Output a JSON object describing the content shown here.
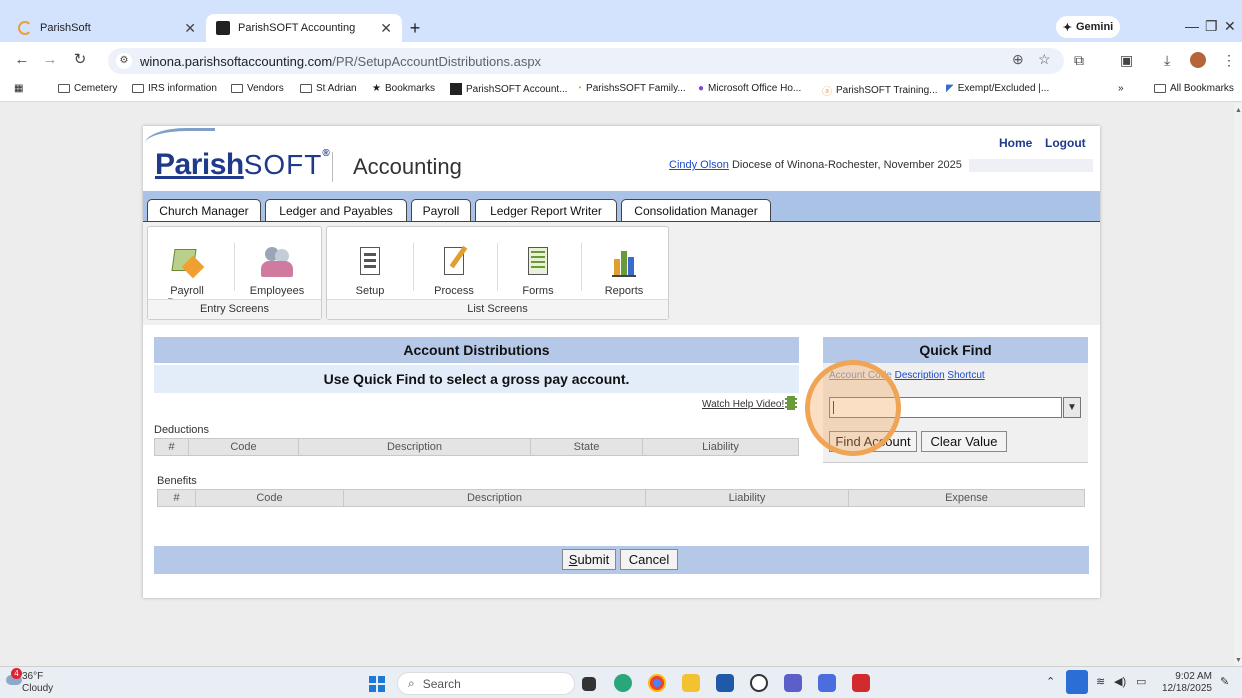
{
  "browser": {
    "tabs": [
      {
        "label": "ParishSoft"
      },
      {
        "label": "ParishSOFT Accounting"
      }
    ],
    "gemini_label": "Gemini",
    "url_host": "winona.parishsoftaccounting.com",
    "url_path": "/PR/SetupAccountDistributions.aspx",
    "bookmarks": [
      "Cemetery",
      "IRS information",
      "Vendors",
      "St Adrian",
      "Bookmarks",
      "ParishSOFT Account...",
      "ParishsSOFT Family...",
      "Microsoft Office Ho...",
      "ParishSOFT Training...",
      "Exempt/Excluded |..."
    ],
    "all_bookmarks": "All Bookmarks",
    "more": "»"
  },
  "header": {
    "logo_parish": "Parish",
    "logo_soft": "SOFT",
    "logo_mark": "®",
    "app_title": "Accounting",
    "home": "Home",
    "logout": "Logout",
    "user_name": "Cindy Olson",
    "user_context": " Diocese of Winona-Rochester, November 2025"
  },
  "module_tabs": [
    "Church Manager",
    "Ledger and Payables",
    "Payroll",
    "Ledger Report Writer",
    "Consolidation Manager"
  ],
  "ribbon": {
    "entry": {
      "label": "Entry Screens",
      "buttons": [
        "Payroll Process",
        "Employees"
      ]
    },
    "list": {
      "label": "List Screens",
      "buttons": [
        "Setup",
        "Process",
        "Forms",
        "Reports"
      ]
    }
  },
  "account_distributions": {
    "title": "Account Distributions",
    "instruction": "Use Quick Find to select a gross pay account.",
    "help_link": "Watch Help Video!",
    "deductions_label": "Deductions",
    "deductions_columns": [
      "#",
      "Code",
      "Description",
      "State",
      "Liability"
    ],
    "benefits_label": "Benefits",
    "benefits_columns": [
      "#",
      "Code",
      "Description",
      "Liability",
      "Expense"
    ],
    "submit_underlined": "S",
    "submit_rest": "ubmit",
    "cancel": "Cancel"
  },
  "quick_find": {
    "title": "Quick Find",
    "link_account_code": "Account Code",
    "link_description": "Description",
    "link_shortcut": "Shortcut",
    "input_value": "",
    "find_button": "Find Account",
    "clear_button": "Clear Value"
  },
  "taskbar": {
    "weather_temp": "36°F",
    "weather_desc": "Cloudy",
    "weather_badge": "4",
    "search_placeholder": "Search",
    "time": "9:02 AM",
    "date": "12/18/2025"
  }
}
